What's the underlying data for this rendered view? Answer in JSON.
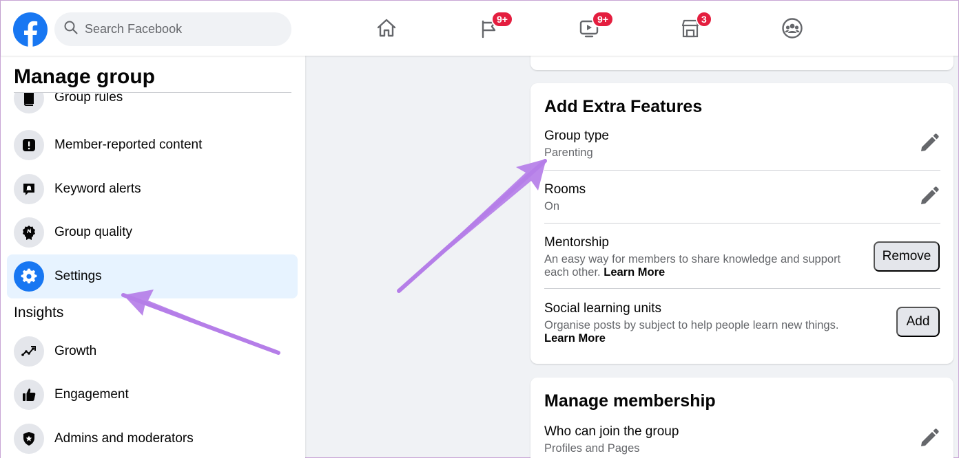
{
  "topbar": {
    "search_placeholder": "Search Facebook",
    "nav": [
      {
        "icon": "home-icon",
        "badge": ""
      },
      {
        "icon": "pages-flag-icon",
        "badge": "9+"
      },
      {
        "icon": "watch-icon",
        "badge": "9+"
      },
      {
        "icon": "marketplace-icon",
        "badge": "3"
      },
      {
        "icon": "groups-icon",
        "badge": ""
      }
    ]
  },
  "sidebar": {
    "title": "Manage group",
    "items": [
      {
        "label": "Group rules",
        "icon": "book-icon"
      },
      {
        "label": "Member-reported content",
        "icon": "alert-icon"
      },
      {
        "label": "Keyword alerts",
        "icon": "keyword-alert-icon"
      },
      {
        "label": "Group quality",
        "icon": "quality-badge-icon"
      },
      {
        "label": "Settings",
        "icon": "gear-icon",
        "active": true
      }
    ],
    "insights_header": "Insights",
    "insights_items": [
      {
        "label": "Growth",
        "icon": "growth-icon"
      },
      {
        "label": "Engagement",
        "icon": "thumbs-up-icon"
      },
      {
        "label": "Admins and moderators",
        "icon": "shield-icon"
      }
    ]
  },
  "extra_features": {
    "title": "Add Extra Features",
    "group_type": {
      "label": "Group type",
      "value": "Parenting"
    },
    "rooms": {
      "label": "Rooms",
      "value": "On"
    },
    "mentorship": {
      "label": "Mentorship",
      "description": "An easy way for members to share knowledge and support each other.",
      "link": "Learn More",
      "button": "Remove"
    },
    "social_learning": {
      "label": "Social learning units",
      "description": "Organise posts by subject to help people learn new things.",
      "link_1": "Learn",
      "link_2": "More",
      "button": "Add"
    }
  },
  "membership": {
    "title": "Manage membership",
    "who_can_join": {
      "label": "Who can join the group",
      "value": "Profiles and Pages"
    }
  },
  "colors": {
    "facebook_blue": "#1877f2",
    "badge_red": "#e41e3f",
    "annotation_arrow": "#b57ee8"
  }
}
